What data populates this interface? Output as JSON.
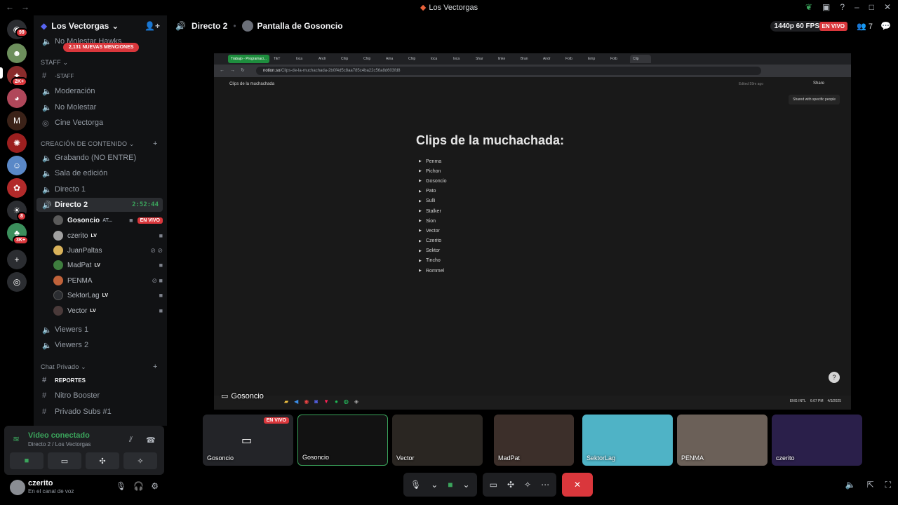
{
  "window": {
    "title": "Los Vectorgas"
  },
  "server": {
    "name": "Los Vectorgas",
    "mentions_banner": "2,131 NUEVAS MENCIONES"
  },
  "guild_badges": {
    "home": "99",
    "g2": "2K+",
    "g8": "8",
    "g9": "3K+"
  },
  "channels": {
    "top_partial": "No Molestar Hawks",
    "staff_category": "STAFF",
    "staff": [
      "-STAFF",
      "Moderación",
      "No Molestar",
      "Cine Vectorga"
    ],
    "content_category": "CREACIÓN DE CONTENIDO",
    "content": [
      "Grabando (NO ENTRE)",
      "Sala de edición",
      "Directo 1"
    ],
    "active": {
      "name": "Directo 2",
      "time": "2:52:44"
    },
    "voice_users": [
      {
        "name": "Gosoncio",
        "extra": "AT...",
        "live": "EN VIVO",
        "color": "#5a5a5a"
      },
      {
        "name": "czerito",
        "extra": "LV",
        "color": "#a0a0a0"
      },
      {
        "name": "JuanPaltas",
        "extra": "",
        "color": "#d9b25a"
      },
      {
        "name": "MadPat",
        "extra": "LV",
        "color": "#3e7d3e"
      },
      {
        "name": "PENMA",
        "extra": "",
        "color": "#c0623a"
      },
      {
        "name": "SektorLag",
        "extra": "LV",
        "color": "#2b2d31"
      },
      {
        "name": "Vector",
        "extra": "LV",
        "color": "#4a3a3a"
      }
    ],
    "viewers": [
      "Viewers 1",
      "Viewers 2"
    ],
    "private_category": "Chat Privado",
    "private": [
      "REPORTES",
      "Nitro Booster",
      "Privado Subs #1"
    ]
  },
  "voice_panel": {
    "status": "Video conectado",
    "location": "Directo 2 / Los Vectorgas"
  },
  "user": {
    "name": "czerito",
    "status": "En el canal de voz"
  },
  "stage": {
    "channel": "Directo 2",
    "screen_title": "Pantalla de Gosoncio",
    "quality": "1440p 60 FPS",
    "live": "EN VIVO",
    "viewers": "7"
  },
  "browser": {
    "group_tab": "Trabajo - Programaci...",
    "tabs": [
      "TikT",
      "loca",
      "Andr",
      "Chip",
      "Chip",
      "Ama",
      "Chip",
      "loca",
      "loca",
      "Shar",
      "linke",
      "Bran",
      "Andr",
      "Fotb",
      "Emp",
      "Fotb",
      "Clip"
    ],
    "url_host": "notion.so",
    "url_path": "/Clips-de-la-muchachada-2b0f4d5c8aa785c4ba22c56a8d603fd8"
  },
  "notion": {
    "breadcrumb": "Clips de la muchachada",
    "edited": "Edited 59m ago",
    "share": "Share",
    "tooltip": "Shared with specific people",
    "title": "Clips de la muchachada:",
    "items": [
      "Penma",
      "Pichon",
      "Gosoncio",
      "Pato",
      "Sulli",
      "Stalker",
      "Sion",
      "Vector",
      "Czerito",
      "Sektor",
      "Tincho",
      "Rommel"
    ]
  },
  "taskbar": {
    "lang": "ENG INTL",
    "time": "6:07 PM",
    "date": "4/3/2025"
  },
  "screen_owner": "Gosoncio",
  "tiles": [
    {
      "name": "Gosoncio",
      "live": "EN VIVO",
      "bg": "#232428"
    },
    {
      "name": "Gosoncio",
      "bg": "#121212"
    },
    {
      "name": "Vector",
      "bg": "#2a2622"
    },
    {
      "name": "MadPat",
      "bg": "#3c2f2a"
    },
    {
      "name": "SektorLag",
      "bg": "#4fb3c6"
    },
    {
      "name": "PENMA",
      "bg": "#6b6058"
    },
    {
      "name": "czerito",
      "bg": "#2a1f4a"
    }
  ],
  "icons": {
    "mic": "mic-icon",
    "camera": "camera-icon",
    "share": "screen-share-icon",
    "hangup": "hangup-icon"
  }
}
